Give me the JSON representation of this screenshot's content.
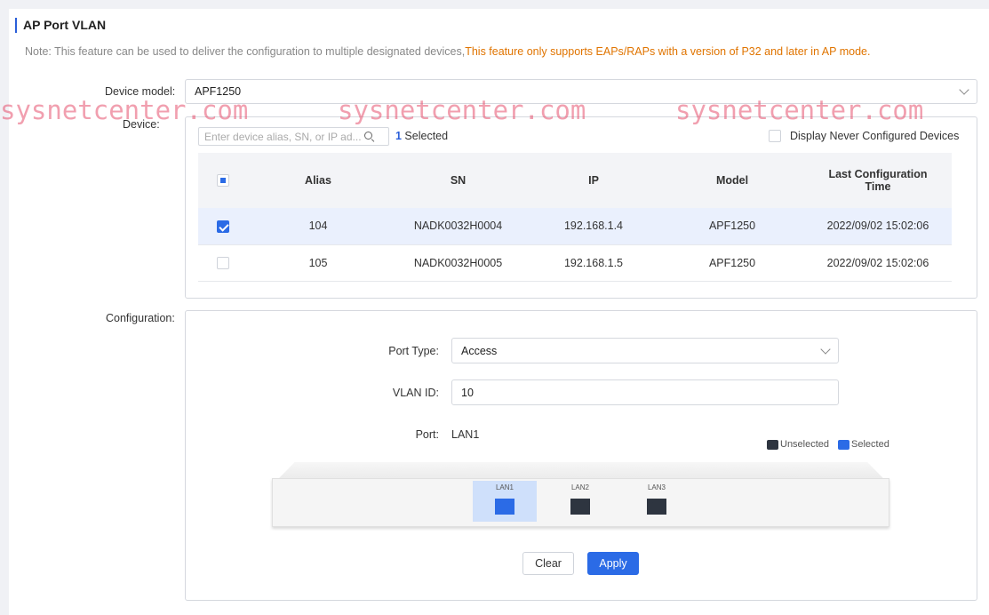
{
  "page": {
    "title": "AP Port VLAN",
    "note_prefix": "Note: This feature can be used to deliver the configuration to multiple designated devices,",
    "note_warning": "This feature only supports EAPs/RAPs with a version of P32 and later in AP mode."
  },
  "device_model": {
    "label": "Device model:",
    "value": "APF1250"
  },
  "device": {
    "label": "Device:",
    "search_placeholder": "Enter device alias, SN, or IP ad...",
    "selected_count": "1",
    "selected_suffix": " Selected",
    "never_configured_label": "Display Never Configured Devices",
    "columns": {
      "alias": "Alias",
      "sn": "SN",
      "ip": "IP",
      "model": "Model",
      "last_config_1": "Last Configuration",
      "last_config_2": "Time"
    },
    "rows": [
      {
        "alias": "104",
        "sn": "NADK0032H0004",
        "ip": "192.168.1.4",
        "model": "APF1250",
        "time": "2022/09/02 15:02:06",
        "checked": true
      },
      {
        "alias": "105",
        "sn": "NADK0032H0005",
        "ip": "192.168.1.5",
        "model": "APF1250",
        "time": "2022/09/02 15:02:06",
        "checked": false
      }
    ]
  },
  "configuration": {
    "label": "Configuration:",
    "port_type_label": "Port Type",
    "port_type_value": "Access",
    "vlan_id_label": "VLAN ID",
    "vlan_id_value": "10",
    "port_label": "Port",
    "port_value": "LAN1",
    "legend_unselected": "Unselected",
    "legend_selected": "Selected",
    "ports": [
      {
        "name": "LAN1",
        "selected": true
      },
      {
        "name": "LAN2",
        "selected": false
      },
      {
        "name": "LAN3",
        "selected": false
      }
    ]
  },
  "buttons": {
    "clear": "Clear",
    "apply": "Apply"
  },
  "watermark": "sysnetcenter.com",
  "colors": {
    "accent": "#2b6be6",
    "warning": "#e07400",
    "port_unselected": "#2e3540",
    "port_selected": "#2b6be6",
    "selected_row": "#eaf0fd"
  }
}
